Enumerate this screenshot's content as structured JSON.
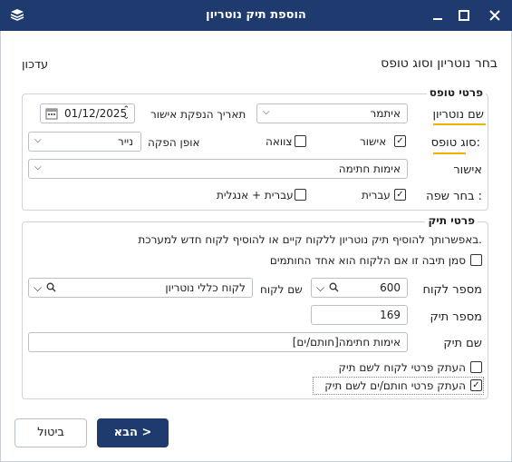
{
  "window": {
    "title": "הוספת תיק נוטריון",
    "controls": {
      "close": "✕",
      "maximize": "☐",
      "minimize": "—"
    }
  },
  "header": {
    "title": "בחר נוטריון וסוג טופס",
    "update_link": "עדכון"
  },
  "form_details": {
    "legend": "פרטי טופס",
    "notary_label": "שם נוטריון",
    "notary_value": "איתמר",
    "issue_date_label": "תאריך הנפקת אישור",
    "issue_date_value": "01/12/2025",
    "form_type_label": "סוג טופס:",
    "type_approval_label": "אישור",
    "type_approval_checked": true,
    "type_will_label": "צוואה",
    "type_will_checked": false,
    "production_method_label": "אופן הפקה",
    "production_method_value": "נייר",
    "approval_label": "אישור",
    "approval_value": "אימות חתימה",
    "language_label": "בחר שפה :",
    "lang_hebrew_label": "עברית",
    "lang_hebrew_checked": true,
    "lang_heb_eng_label": "עברית + אנגלית",
    "lang_heb_eng_checked": false
  },
  "case_details": {
    "legend": "פרטי תיק",
    "description": "באפשרותך להוסיף תיק נוטריון ללקוח קיים או להוסיף לקוח חדש למערכת.",
    "mark_client_signer_label": "סמן תיבה זו אם הלקוח הוא אחד החותמים",
    "mark_client_signer_checked": false,
    "client_number_label": "מספר לקוח",
    "client_number_value": "600",
    "client_name_label": "שם לקוח",
    "client_name_value": "לקוח כללי נוטריון",
    "case_number_label": "מספר תיק",
    "case_number_value": "169",
    "case_name_label": "שם תיק",
    "case_name_value": "אימות חתימה[חותם/ים]",
    "copy_client_label": "העתק פרטי לקוח לשם תיק",
    "copy_client_checked": false,
    "copy_signers_label": "העתק פרטי חותם/ים לשם תיק",
    "copy_signers_checked": true
  },
  "footer": {
    "next_label": "הבא >",
    "cancel_label": "ביטול"
  },
  "colors": {
    "titlebar": "#1f3a6e",
    "accent_underline": "#f0b400",
    "primary_button": "#1f3a6e"
  }
}
